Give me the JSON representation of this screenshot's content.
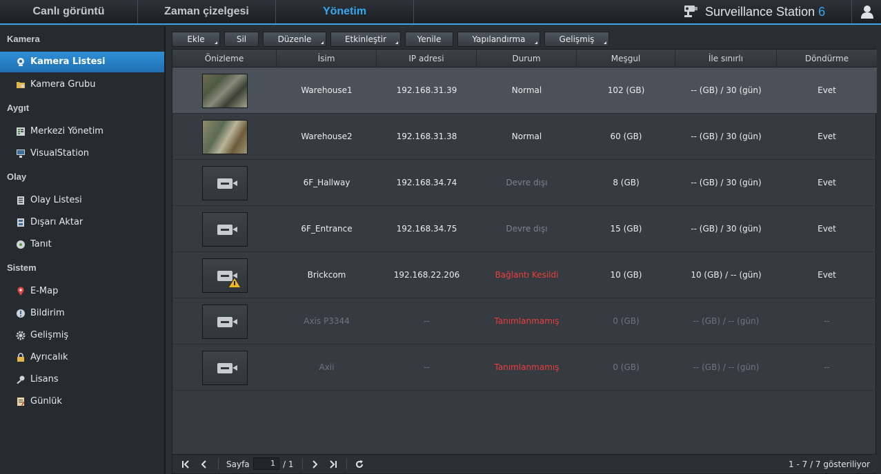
{
  "topnav": {
    "tabs": [
      {
        "label": "Canlı görüntü"
      },
      {
        "label": "Zaman çizelgesi"
      },
      {
        "label": "Yönetim"
      }
    ],
    "brand": "Surveillance Station",
    "version": "6"
  },
  "sidebar": {
    "sections": [
      {
        "title": "Kamera",
        "items": [
          {
            "label": "Kamera Listesi",
            "icon": "camera-icon"
          },
          {
            "label": "Kamera Grubu",
            "icon": "folder-camera-icon"
          }
        ]
      },
      {
        "title": "Aygıt",
        "items": [
          {
            "label": "Merkezi Yönetim",
            "icon": "central-management-icon"
          },
          {
            "label": "VisualStation",
            "icon": "visualstation-icon"
          }
        ]
      },
      {
        "title": "Olay",
        "items": [
          {
            "label": "Olay Listesi",
            "icon": "event-list-icon"
          },
          {
            "label": "Dışarı Aktar",
            "icon": "film-export-icon"
          },
          {
            "label": "Tanıt",
            "icon": "disc-icon"
          }
        ]
      },
      {
        "title": "Sistem",
        "items": [
          {
            "label": "E-Map",
            "icon": "map-pin-icon"
          },
          {
            "label": "Bildirim",
            "icon": "notification-icon"
          },
          {
            "label": "Gelişmiş",
            "icon": "gear-icon"
          },
          {
            "label": "Ayrıcalık",
            "icon": "lock-icon"
          },
          {
            "label": "Lisans",
            "icon": "key-icon"
          },
          {
            "label": "Günlük",
            "icon": "log-icon"
          }
        ]
      }
    ]
  },
  "toolbar": {
    "buttons": [
      {
        "label": "Ekle",
        "dropdown": true
      },
      {
        "label": "Sil",
        "dropdown": false
      },
      {
        "label": "Düzenle",
        "dropdown": true
      },
      {
        "label": "Etkinleştir",
        "dropdown": true
      },
      {
        "label": "Yenile",
        "dropdown": false
      },
      {
        "label": "Yapılandırma",
        "dropdown": true
      },
      {
        "label": "Gelişmiş",
        "dropdown": true
      }
    ]
  },
  "table": {
    "headers": [
      "Önizleme",
      "İsim",
      "IP adresi",
      "Durum",
      "Meşgul",
      "İle sınırlı",
      "Döndürme"
    ],
    "rows": [
      {
        "name": "Warehouse1",
        "ip": "192.168.31.39",
        "status": "Normal",
        "used": "102 (GB)",
        "limit": "-- (GB) / 30 (gün)",
        "rotate": "Evet",
        "preview": "image"
      },
      {
        "name": "Warehouse2",
        "ip": "192.168.31.38",
        "status": "Normal",
        "used": "60 (GB)",
        "limit": "-- (GB) / 30 (gün)",
        "rotate": "Evet",
        "preview": "image"
      },
      {
        "name": "6F_Hallway",
        "ip": "192.168.34.74",
        "status": "Devre dışı",
        "used": "8 (GB)",
        "limit": "-- (GB) / 30 (gün)",
        "rotate": "Evet",
        "preview": "placeholder"
      },
      {
        "name": "6F_Entrance",
        "ip": "192.168.34.75",
        "status": "Devre dışı",
        "used": "15 (GB)",
        "limit": "-- (GB) / 30 (gün)",
        "rotate": "Evet",
        "preview": "placeholder"
      },
      {
        "name": "Brickcom",
        "ip": "192.168.22.206",
        "status": "Bağlantı Kesildi",
        "used": "10 (GB)",
        "limit": "10 (GB) / -- (gün)",
        "rotate": "Evet",
        "preview": "warning"
      },
      {
        "name": "Axis P3344",
        "ip": "--",
        "status": "Tanımlanmamış",
        "used": "0 (GB)",
        "limit": "-- (GB) / -- (gün)",
        "rotate": "--",
        "preview": "placeholder"
      },
      {
        "name": "Axii",
        "ip": "--",
        "status": "Tanımlanmamış",
        "used": "0 (GB)",
        "limit": "-- (GB) / -- (gün)",
        "rotate": "--",
        "preview": "placeholder"
      }
    ]
  },
  "pager": {
    "page_label": "Sayfa",
    "page_value": "1",
    "total": "/ 1",
    "summary": "1 - 7 / 7 gösteriliyor"
  },
  "colors": {
    "accent": "#38a7ef",
    "error": "#ee3d3d",
    "selected": "#2f8fd6"
  }
}
